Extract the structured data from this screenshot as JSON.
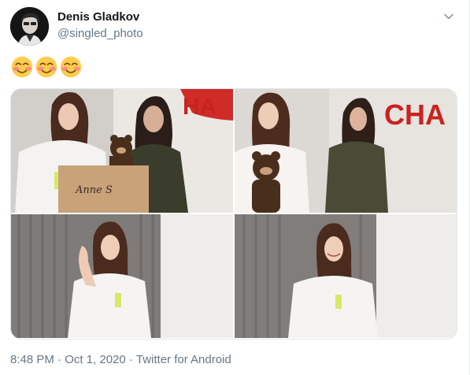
{
  "tweet": {
    "author_name": "Denis Gladkov",
    "author_handle": "@singled_photo",
    "text_emojis": [
      "smiling-face-with-smiling-eyes",
      "smiling-face-with-smiling-eyes",
      "smiling-face-with-smiling-eyes"
    ],
    "time": "8:48 PM",
    "date": "Oct 1, 2020",
    "source": "Twitter for Android",
    "separator": "·"
  },
  "photos": [
    {
      "alt_subject": "two girls with box and teddy bear",
      "box_text": "Anne S"
    },
    {
      "alt_subject": "two girls holding teddy bear"
    },
    {
      "alt_subject": "girl waving"
    },
    {
      "alt_subject": "girl smiling"
    }
  ],
  "icons": {
    "caret": "chevron-down-icon",
    "emoji": "smiling-face-icon"
  },
  "colors": {
    "secondary_text": "#657786",
    "primary_text": "#14171a",
    "border": "#e1e8ed"
  }
}
